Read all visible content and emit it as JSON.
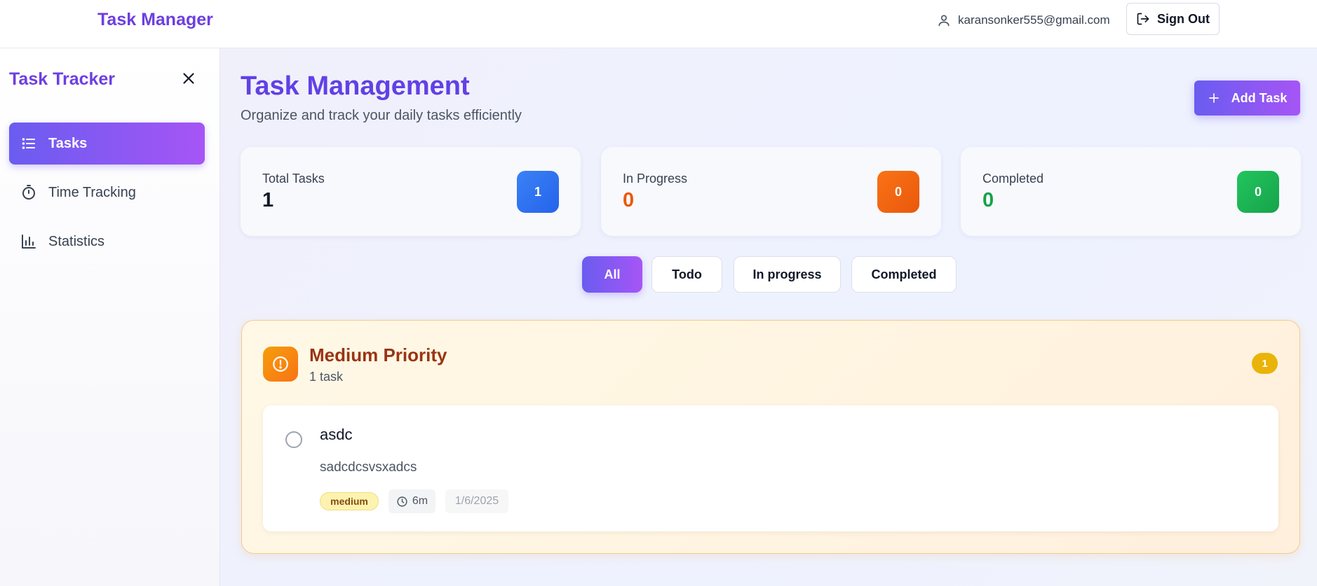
{
  "header": {
    "brand": "Task Manager",
    "user_email": "karansonker555@gmail.com",
    "sign_out_label": "Sign Out"
  },
  "sidebar": {
    "title": "Task Tracker",
    "items": [
      {
        "label": "Tasks",
        "icon": "list-icon",
        "active": true
      },
      {
        "label": "Time Tracking",
        "icon": "stopwatch-icon",
        "active": false
      },
      {
        "label": "Statistics",
        "icon": "bar-chart-icon",
        "active": false
      }
    ]
  },
  "main": {
    "title": "Task Management",
    "subtitle": "Organize and track your daily tasks efficiently",
    "add_task_label": "Add Task",
    "stats": [
      {
        "label": "Total Tasks",
        "value": "1",
        "badge": "1",
        "color": "#111827",
        "badge_color": "#2563eb"
      },
      {
        "label": "In Progress",
        "value": "0",
        "badge": "0",
        "color": "#ea580c",
        "badge_color": "#f97316"
      },
      {
        "label": "Completed",
        "value": "0",
        "badge": "0",
        "color": "#16a34a",
        "badge_color": "#22c55e"
      }
    ],
    "filters": [
      {
        "label": "All",
        "active": true
      },
      {
        "label": "Todo",
        "active": false
      },
      {
        "label": "In progress",
        "active": false
      },
      {
        "label": "Completed",
        "active": false
      }
    ],
    "group": {
      "title": "Medium Priority",
      "subtitle": "1 task",
      "count": "1",
      "tasks": [
        {
          "title": "asdc",
          "description": "sadcdcsvsxadcs",
          "priority": "medium",
          "time": "6m",
          "date": "1/6/2025"
        }
      ]
    }
  },
  "colors": {
    "accent_start": "#6a5cf0",
    "accent_end": "#a655f5",
    "brand": "#6d3fe0"
  }
}
